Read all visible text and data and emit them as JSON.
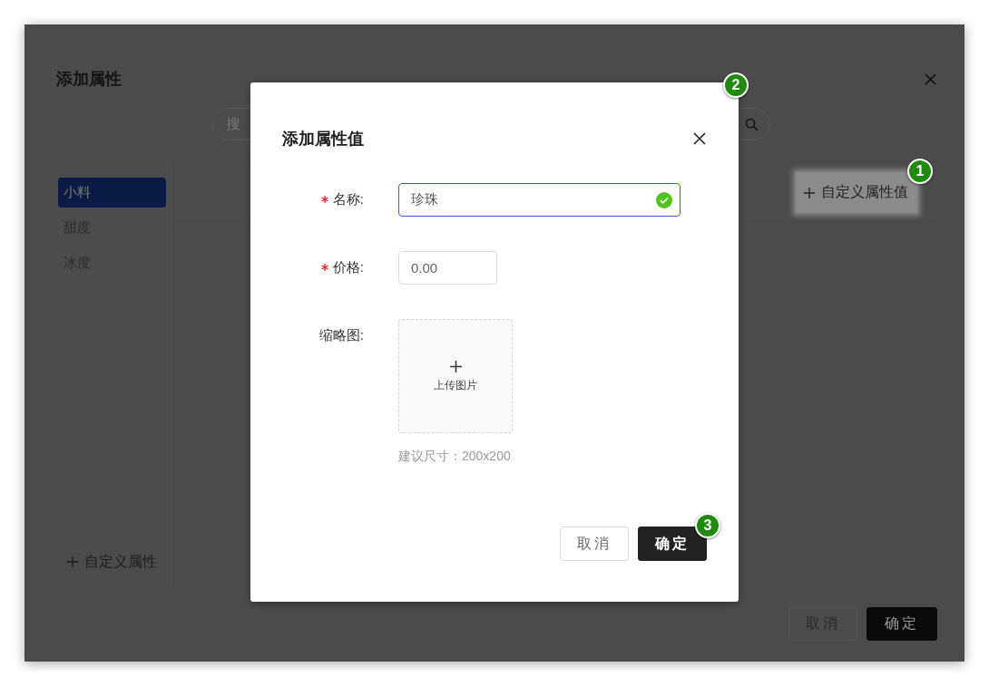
{
  "outer_dialog": {
    "title": "添加属性",
    "search": {
      "placeholder": "搜"
    },
    "categories": [
      {
        "label": "小料",
        "selected": true
      },
      {
        "label": "甜度",
        "selected": false
      },
      {
        "label": "冰度",
        "selected": false
      }
    ],
    "add_category_button": {
      "label": "自定义属性"
    },
    "add_value_button": {
      "label": "自定义属性值",
      "highlighted": true,
      "callout": "1"
    },
    "buttons": [
      {
        "label": "取消",
        "kind": "secondary"
      },
      {
        "label": "确定",
        "kind": "primary"
      }
    ]
  },
  "modal": {
    "title": "添加属性值",
    "callout": "2",
    "fields": [
      {
        "kind": "text",
        "label": "名称:",
        "required": true,
        "value": "珍珠",
        "valid": true,
        "focused": true
      },
      {
        "kind": "number",
        "label": "价格:",
        "required": true,
        "placeholder": "0.00"
      },
      {
        "kind": "upload",
        "label": "缩略图:",
        "required": false,
        "upload_label": "上传图片",
        "hint": "建议尺寸：200x200"
      }
    ],
    "buttons": [
      {
        "label": "取消",
        "kind": "secondary"
      },
      {
        "label": "确定",
        "kind": "primary",
        "callout": "3"
      }
    ]
  }
}
